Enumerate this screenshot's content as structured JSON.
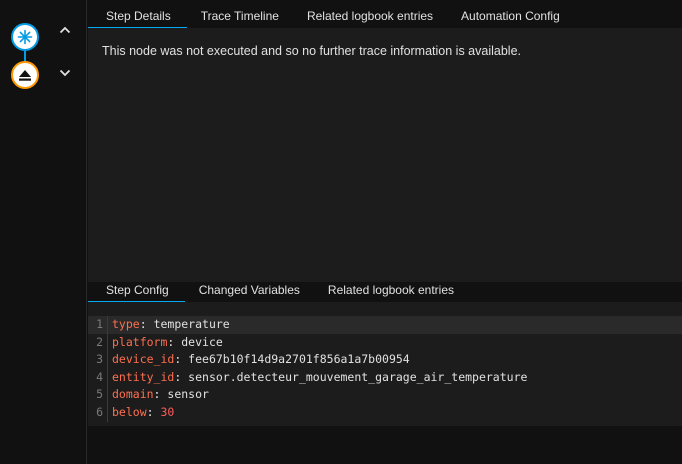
{
  "colors": {
    "accent": "#03a9f4",
    "trigger_border": "#039be5",
    "condition_border": "#ff9800",
    "yaml_key": "#ff6f4f",
    "yaml_number": "#ff5c5c"
  },
  "graph": {
    "nodes": [
      {
        "type": "trigger",
        "icon": "asterisk-icon"
      },
      {
        "type": "condition",
        "icon": "eject-icon"
      }
    ],
    "controls": [
      "chevron-up-icon",
      "chevron-down-icon"
    ]
  },
  "top_tabs": [
    {
      "label": "Step Details",
      "active": true
    },
    {
      "label": "Trace Timeline",
      "active": false
    },
    {
      "label": "Related logbook entries",
      "active": false
    },
    {
      "label": "Automation Config",
      "active": false
    }
  ],
  "details": {
    "message": "This node was not executed and so no further trace information is available."
  },
  "bottom_tabs": [
    {
      "label": "Step Config",
      "active": true
    },
    {
      "label": "Changed Variables",
      "active": false
    },
    {
      "label": "Related logbook entries",
      "active": false
    }
  ],
  "config_lines": [
    {
      "num": "1",
      "key": "type",
      "value": "temperature",
      "type": "string"
    },
    {
      "num": "2",
      "key": "platform",
      "value": "device",
      "type": "string"
    },
    {
      "num": "3",
      "key": "device_id",
      "value": "fee67b10f14d9a2701f856a1a7b00954",
      "type": "string"
    },
    {
      "num": "4",
      "key": "entity_id",
      "value": "sensor.detecteur_mouvement_garage_air_temperature",
      "type": "string"
    },
    {
      "num": "5",
      "key": "domain",
      "value": "sensor",
      "type": "string"
    },
    {
      "num": "6",
      "key": "below",
      "value": "30",
      "type": "number"
    }
  ],
  "punct": {
    "colon": ": "
  }
}
